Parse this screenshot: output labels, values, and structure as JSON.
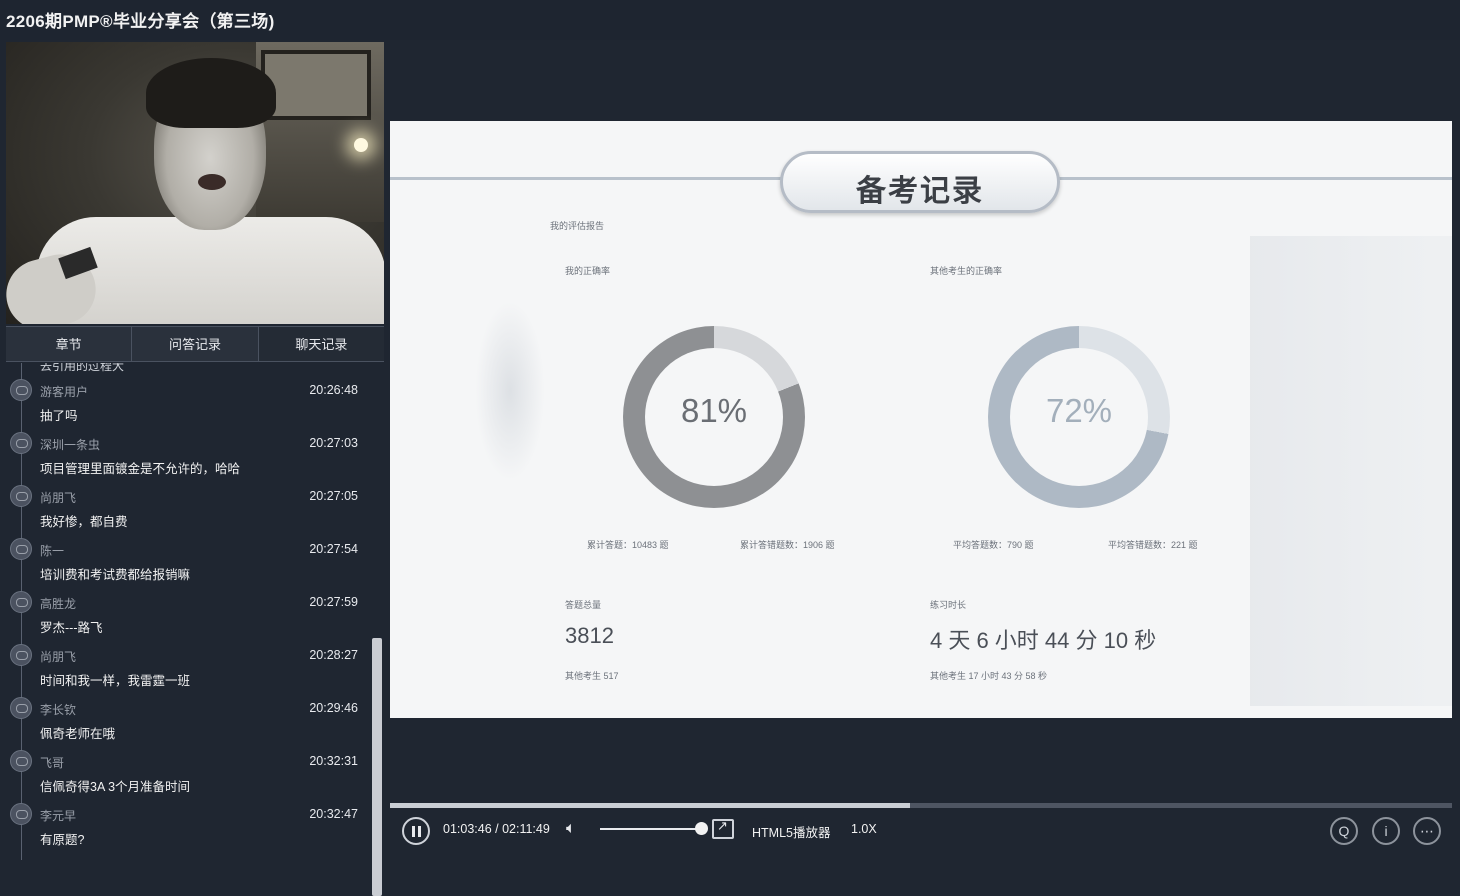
{
  "window": {
    "title": "2206期PMP®毕业分享会（第三场)"
  },
  "tabs": [
    {
      "label": "章节"
    },
    {
      "label": "问答记录"
    },
    {
      "label": "聊天记录"
    }
  ],
  "chat": {
    "cut_text": "去引用的过程大",
    "messages": [
      {
        "user": "游客用户",
        "time": "20:26:48",
        "text": "抽了吗"
      },
      {
        "user": "深圳一条虫",
        "time": "20:27:03",
        "text": "项目管理里面镀金是不允许的，哈哈"
      },
      {
        "user": "尚朋飞",
        "time": "20:27:05",
        "text": "我好惨，都自费"
      },
      {
        "user": "陈一",
        "time": "20:27:54",
        "text": "培训费和考试费都给报销嘛"
      },
      {
        "user": "高胜龙",
        "time": "20:27:59",
        "text": "罗杰---路飞"
      },
      {
        "user": "尚朋飞",
        "time": "20:28:27",
        "text": "时间和我一样，我雷霆一班"
      },
      {
        "user": "李长钦",
        "time": "20:29:46",
        "text": "佩奇老师在哦"
      },
      {
        "user": "飞哥",
        "time": "20:32:31",
        "text": "信佩奇得3A 3个月准备时间"
      },
      {
        "user": "李元早",
        "time": "20:32:47",
        "text": "有原题?"
      }
    ]
  },
  "slide": {
    "title": "备考记录",
    "report_label": "我的评估报告",
    "my_rate_label": "我的正确率",
    "others_rate_label": "其他考生的正确率",
    "my_rate": "81%",
    "my_rate_value": 81,
    "others_rate": "72%",
    "others_rate_value": 72,
    "total_answered": "累计答题：10483 题",
    "total_wrong": "累计答错题数：1906 题",
    "avg_answered": "平均答题数：790 题",
    "avg_wrong": "平均答错题数：221 题",
    "question_total_label": "答题总量",
    "question_total": "3812",
    "others_total": "其他考生    517",
    "practice_label": "练习时长",
    "practice_time": "4 天 6 小时 44 分 10 秒",
    "others_time": "其他考生    17 小时 43 分 58 秒"
  },
  "player": {
    "time": "01:03:46 / 02:11:49",
    "progress": 0.49,
    "volume": 0.95,
    "player_label": "HTML5播放器",
    "speed": "1.0X"
  },
  "colors": {
    "my_ring": "#8e9093",
    "my_ring_rest": "#d6d8db",
    "others_ring": "#aeb9c5",
    "others_ring_rest": "#dde2e7",
    "slide_text": "#6c727b"
  }
}
